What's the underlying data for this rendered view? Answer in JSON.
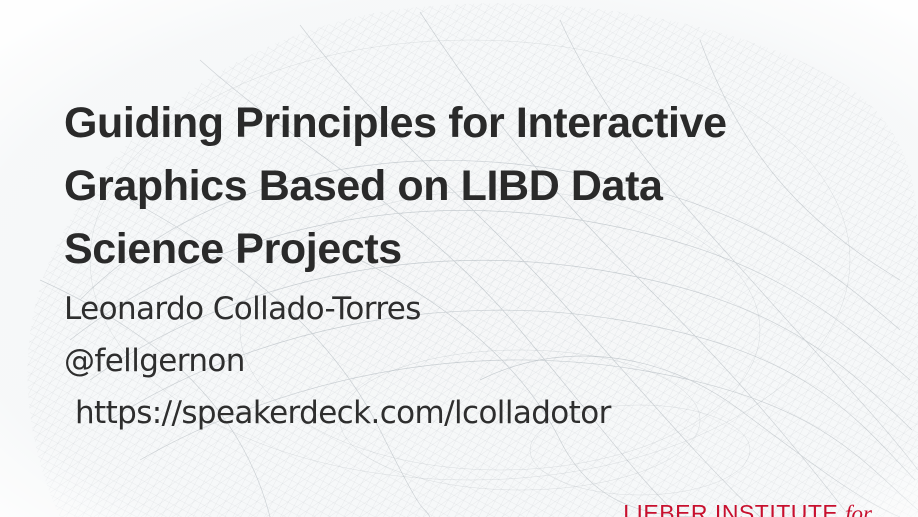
{
  "slide": {
    "title_lines": [
      "Guiding Principles for Interactive",
      "Graphics Based on LIBD Data",
      "Science Projects"
    ],
    "author": {
      "name": "Leonardo Collado-Torres",
      "handle": "@fellgernon",
      "url": "https://speakerdeck.com/lcolladotor"
    },
    "footer": {
      "logo_text": "LIEBER INSTITUTE",
      "logo_suffix": "for",
      "logo_color": "#c8102e"
    },
    "background_icon": "brain-fiber-mesh-icon",
    "text_color": "#2a2a2a"
  }
}
